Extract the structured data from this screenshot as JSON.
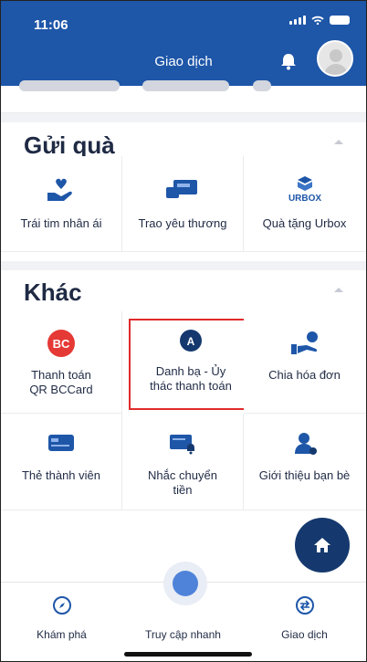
{
  "status_bar": {
    "time": "11:06"
  },
  "header": {
    "title": "Giao dịch"
  },
  "sections": {
    "gift": {
      "title": "Gửi quà",
      "items": [
        {
          "label": "Trái tim nhân ái",
          "icon": "heart-hand-icon"
        },
        {
          "label": "Trao yêu thương",
          "icon": "gift-card-icon"
        },
        {
          "label": "Quà tặng Urbox",
          "icon": "urbox-logo-icon",
          "logo_text": "URBOX"
        }
      ]
    },
    "other": {
      "title": "Khác",
      "items": [
        {
          "label_line1": "Thanh toán",
          "label_line2": "QR BCCard",
          "icon": "bccard-logo-icon",
          "logo_text": "BC"
        },
        {
          "label_line1": "Danh bạ - Ủy",
          "label_line2": "thác thanh toán",
          "icon": "contacts-icon",
          "badge": "A"
        },
        {
          "label_line1": "Chia hóa đơn",
          "label_line2": "",
          "icon": "split-bill-icon"
        },
        {
          "label_line1": "Thẻ thành viên",
          "label_line2": "",
          "icon": "member-card-icon"
        },
        {
          "label_line1": "Nhắc chuyển",
          "label_line2": "tiền",
          "icon": "transfer-reminder-icon"
        },
        {
          "label_line1": "Giới thiệu bạn bè",
          "label_line2": "",
          "icon": "refer-friend-icon"
        }
      ]
    }
  },
  "bottom_nav": [
    {
      "label": "Khám phá",
      "icon": "compass-icon"
    },
    {
      "label": "Truy cập nhanh",
      "icon": "quick-access-icon"
    },
    {
      "label": "Giao dịch",
      "icon": "exchange-icon"
    }
  ],
  "colors": {
    "header_bg": "#1e56a8",
    "accent_dark": "#15396e",
    "icon_blue": "#1e56a8",
    "highlight_border": "#e02b2b",
    "bccard_red": "#e53935"
  }
}
